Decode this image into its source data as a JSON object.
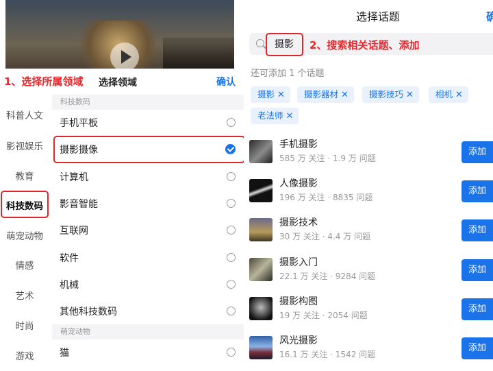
{
  "annotations": {
    "step1": "1、选择所属领域",
    "step2": "2、搜索相关话题、添加"
  },
  "left_panel": {
    "title": "选择领域",
    "confirm": "确认",
    "categories": [
      "科普人文",
      "影视娱乐",
      "教育",
      "科技数码",
      "萌宠动物",
      "情感",
      "艺术",
      "时尚",
      "游戏"
    ],
    "selected_category": "科技数码",
    "groups": [
      {
        "header": "科技数码",
        "items": [
          {
            "label": "手机平板",
            "selected": false
          },
          {
            "label": "摄影摄像",
            "selected": true
          },
          {
            "label": "计算机",
            "selected": false
          },
          {
            "label": "影音智能",
            "selected": false
          },
          {
            "label": "互联网",
            "selected": false
          },
          {
            "label": "软件",
            "selected": false
          },
          {
            "label": "机械",
            "selected": false
          },
          {
            "label": "其他科技数码",
            "selected": false
          }
        ]
      },
      {
        "header": "萌宠动物",
        "items": [
          {
            "label": "猫",
            "selected": false
          }
        ]
      }
    ]
  },
  "right_panel": {
    "title": "选择话题",
    "title_right_cut": "确",
    "search_value": "摄影",
    "hint": "还可添加 1 个话题",
    "chips": [
      "摄影",
      "摄影器材",
      "摄影技巧",
      "相机",
      "老法师"
    ],
    "chip_remove_glyph": "✕",
    "add_label": "添加",
    "topics": [
      {
        "name": "手机摄影",
        "meta": "585 万 关注 · 1.9 万 问题"
      },
      {
        "name": "人像摄影",
        "meta": "196 万 关注 · 8835 问题"
      },
      {
        "name": "摄影技术",
        "meta": "30 万 关注 · 4.4 万 问题"
      },
      {
        "name": "摄影入门",
        "meta": "22.1 万 关注 · 9284 问题"
      },
      {
        "name": "摄影构图",
        "meta": "19 万 关注 · 2054 问题"
      },
      {
        "name": "风光摄影",
        "meta": "16.1 万 关注 · 1542 问题"
      }
    ]
  },
  "colors": {
    "accent": "#1a73e8",
    "annotation": "#e8262b"
  }
}
